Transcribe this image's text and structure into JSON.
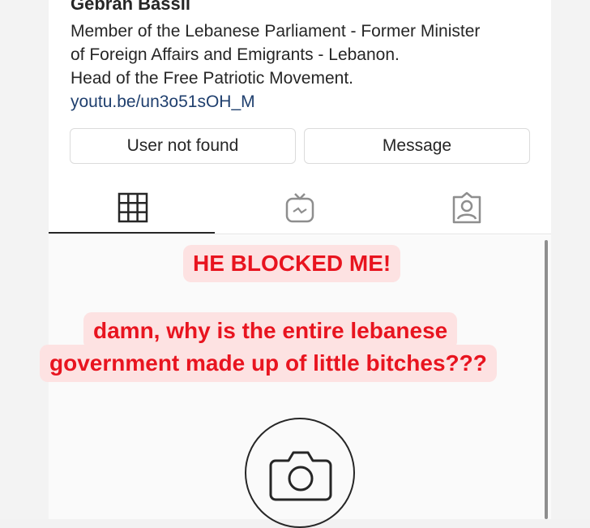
{
  "profile": {
    "name": "Gebran Bassil",
    "bio_lines": [
      "Member of the Lebanese Parliament - Former Minister",
      "of Foreign Affairs and Emigrants - Lebanon.",
      "Head of the Free Patriotic Movement."
    ],
    "link": "youtu.be/un3o51sOH_M"
  },
  "actions": {
    "follow_status": "User not found",
    "message": "Message"
  },
  "tabs": {
    "icons": [
      "grid-icon",
      "igtv-icon",
      "tagged-icon"
    ]
  },
  "captions": {
    "line1": "HE BLOCKED ME!",
    "line2": "damn, why is the entire lebanese",
    "line3": "government made up of little bitches???"
  },
  "empty_state": {
    "icon": "camera-icon"
  },
  "colors": {
    "caption_text": "#e8141f",
    "caption_bg": "#fde2e2",
    "link": "#1f3f6e"
  }
}
